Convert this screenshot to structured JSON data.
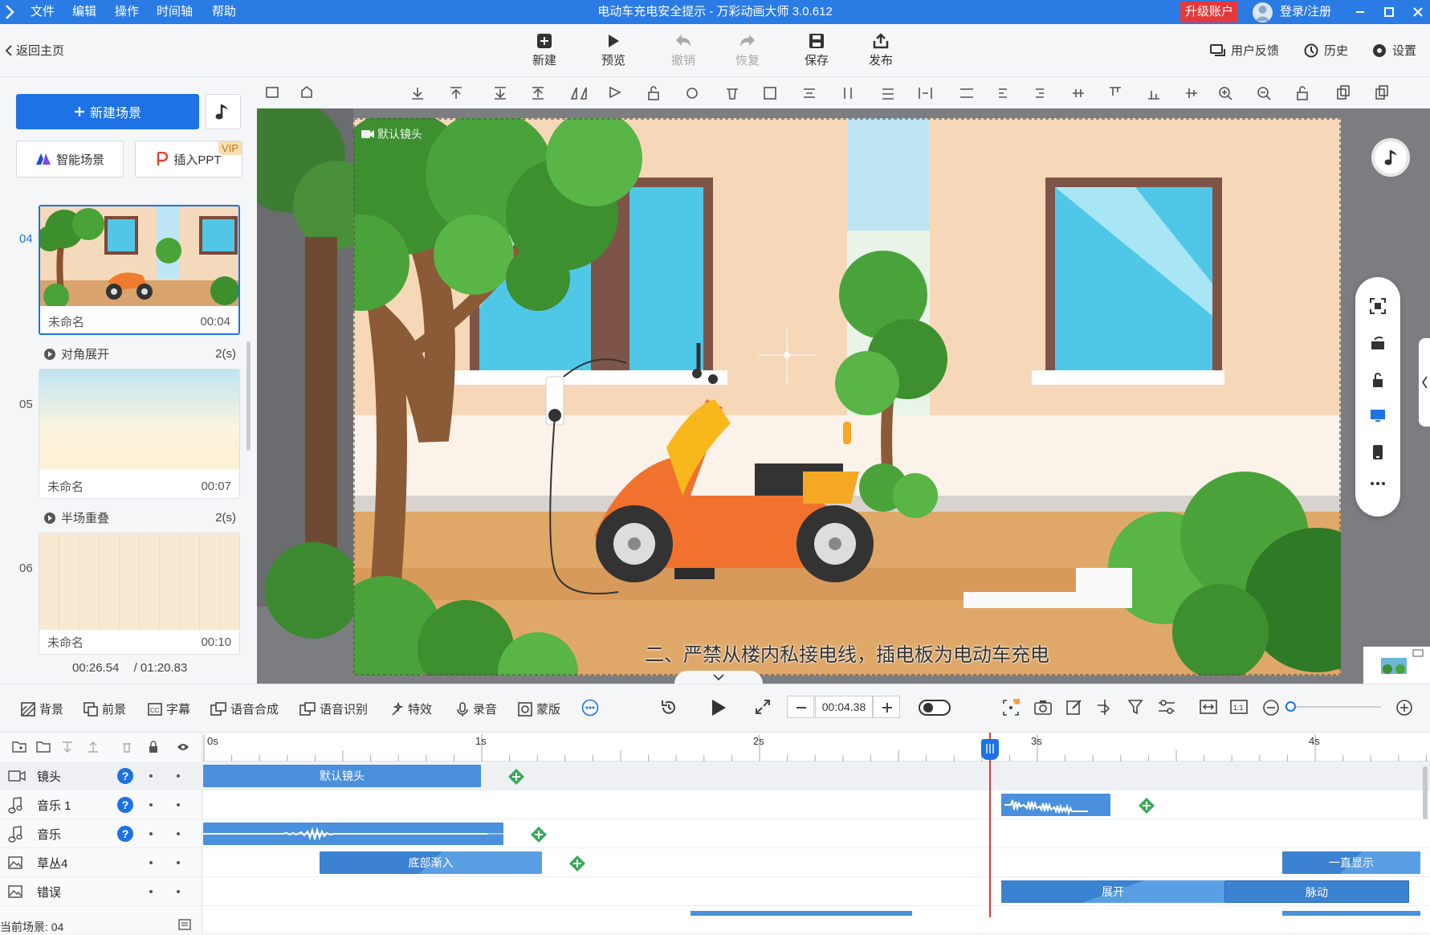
{
  "app": {
    "title": "电动车充电安全提示 - 万彩动画大师 3.0.612",
    "menu": [
      "文件",
      "编辑",
      "操作",
      "时间轴",
      "帮助"
    ],
    "upgrade_label": "升级账户",
    "login_label": "登录/注册",
    "accent_color": "#2b7be4"
  },
  "toolbar": {
    "back_label": "返回主页",
    "buttons": [
      {
        "label": "新建",
        "icon": "plus-square-icon"
      },
      {
        "label": "预览",
        "icon": "play-icon"
      },
      {
        "label": "撤销",
        "icon": "undo-icon",
        "disabled": true
      },
      {
        "label": "恢复",
        "icon": "redo-icon",
        "disabled": true
      },
      {
        "label": "保存",
        "icon": "save-icon"
      },
      {
        "label": "发布",
        "icon": "publish-icon"
      }
    ],
    "feedback_label": "用户反馈",
    "history_label": "历史",
    "settings_label": "设置"
  },
  "left_panel": {
    "new_scene_label": "新建场景",
    "smart_scene_label": "智能场景",
    "insert_ppt_label": "插入PPT",
    "vip_label": "VIP",
    "scenes": [
      {
        "number": "04",
        "name": "未命名",
        "duration": "00:04",
        "selected": true
      },
      {
        "number": "05",
        "name": "未命名",
        "duration": "00:07",
        "selected": false
      },
      {
        "number": "06",
        "name": "未命名",
        "duration": "00:10",
        "selected": false
      }
    ],
    "transitions": [
      {
        "name": "对角展开",
        "duration": "2(s)"
      },
      {
        "name": "半场重叠",
        "duration": "2(s)"
      }
    ],
    "current_time": "00:26.54",
    "total_time": "/ 01:20.83"
  },
  "canvas": {
    "camera_label": "默认镜头",
    "subtitle": "二、严禁从楼内私接电线，插电板为电动车充电"
  },
  "timeline_controls": {
    "items": [
      "背景",
      "前景",
      "字幕",
      "语音合成",
      "语音识别",
      "特效",
      "录音",
      "蒙版"
    ],
    "time_value": "00:04.38"
  },
  "timeline": {
    "ruler": [
      "0s",
      "1s",
      "2s",
      "3s",
      "4s"
    ],
    "tracks": [
      {
        "name": "镜头",
        "icon": "camera-icon",
        "help": true,
        "clips": [
          {
            "label": "默认镜头"
          }
        ]
      },
      {
        "name": "音乐 1",
        "icon": "music-note-icon",
        "help": true,
        "clips": []
      },
      {
        "name": "音乐",
        "icon": "music-note-icon",
        "help": true,
        "clips": []
      },
      {
        "name": "草丛4",
        "icon": "image-icon",
        "help": false,
        "clips": [
          {
            "label": "底部渐入"
          },
          {
            "label": "一直显示"
          }
        ]
      },
      {
        "name": "错误",
        "icon": "image-icon",
        "help": false,
        "clips": [
          {
            "label": "展开"
          },
          {
            "label": "脉动"
          }
        ]
      }
    ],
    "current_scene": "当前场景: 04"
  }
}
